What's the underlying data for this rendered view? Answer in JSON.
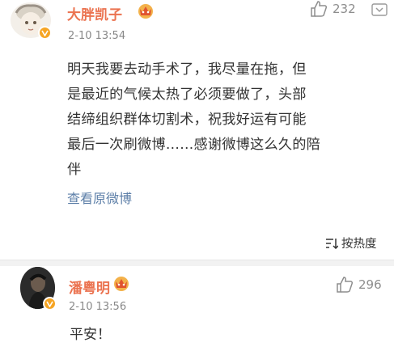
{
  "post": {
    "username": "大胖凯子",
    "timestamp": "2-10 13:54",
    "like_count": "232",
    "content_lines": [
      "明天我要去动手术了，我尽量在拖，但",
      "是最近的气候太热了必须要做了，头部",
      "结缔组织群体切割术，祝我好运有可能",
      "最后一次刷微博……感谢微博这么久的陪",
      "伴"
    ],
    "view_original": "查看原微博"
  },
  "sort": {
    "label": "按热度"
  },
  "reply": {
    "username": "潘粤明",
    "timestamp": "2-10 13:56",
    "like_count": "296",
    "text": "平安！"
  },
  "colors": {
    "username": "#eb7350",
    "link": "#5d7fa8",
    "verified_badge": "#f6a524",
    "divider": "#f2f2f2"
  },
  "icons": [
    "thumbs-up-icon",
    "chevron-down-icon",
    "sort-icon",
    "crown-icon",
    "verified-icon"
  ]
}
